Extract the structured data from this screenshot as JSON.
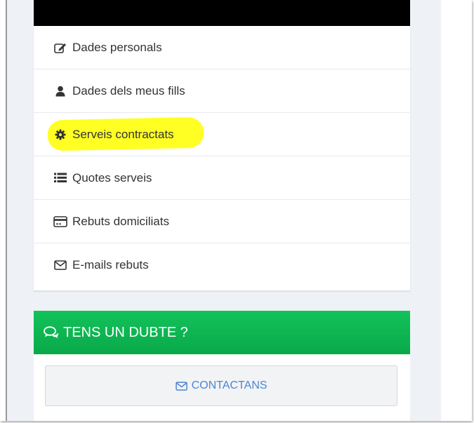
{
  "menu": {
    "items": [
      {
        "label": "Dades personals",
        "icon": "edit-icon"
      },
      {
        "label": "Dades dels meus fills",
        "icon": "user-icon"
      },
      {
        "label": "Serveis contractats",
        "icon": "gear-icon",
        "highlighted": true
      },
      {
        "label": "Quotes serveis",
        "icon": "list-icon"
      },
      {
        "label": "Rebuts domiciliats",
        "icon": "credit-card-icon"
      },
      {
        "label": "E-mails rebuts",
        "icon": "envelope-icon"
      }
    ]
  },
  "help": {
    "title": "TENS UN DUBTE ?",
    "button_label": "CONTACTANS"
  },
  "colors": {
    "header_green": "#0ab04c",
    "highlight": "#ffff24",
    "link_blue": "#4a86d4",
    "top_bar": "#000000"
  }
}
